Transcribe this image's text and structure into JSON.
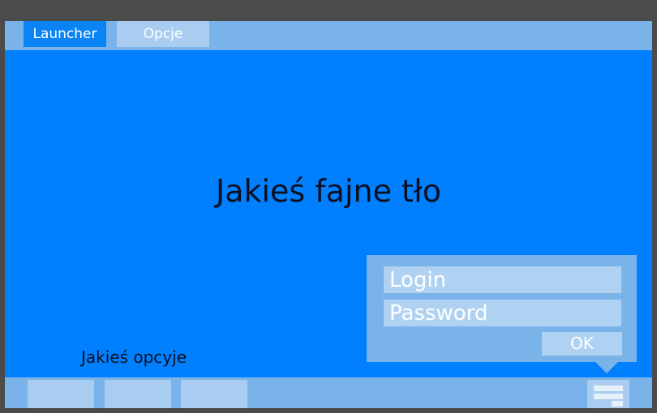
{
  "tabs": [
    {
      "label": "Launcher",
      "active": true
    },
    {
      "label": "Opcje",
      "active": false
    }
  ],
  "main": {
    "background_text": "Jakieś fajne tło",
    "options_label": "Jakieś opcyje"
  },
  "login": {
    "login_placeholder": "Login",
    "password_placeholder": "Password",
    "ok_label": "OK"
  },
  "taskbar": {
    "items": [
      "",
      "",
      ""
    ],
    "menu_icon": "menu-icon"
  },
  "colors": {
    "desktop": "#0080ff",
    "bars": "#7ab3ea",
    "active_tab": "#0a84f5",
    "light_element": "#a8cdf1",
    "frame": "#4b4b4b"
  }
}
